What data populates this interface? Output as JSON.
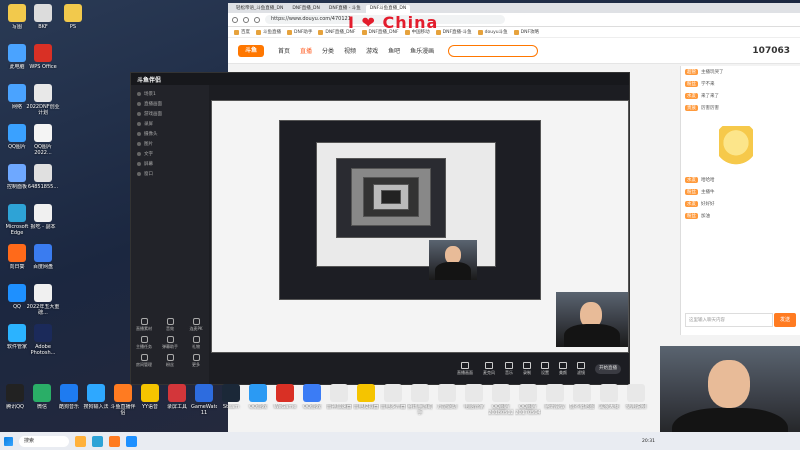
{
  "desktop": {
    "icons_left": [
      {
        "label": "写图",
        "color": "#f2c94c"
      },
      {
        "label": "此电脑",
        "color": "#4aa3ff"
      },
      {
        "label": "网络",
        "color": "#4aa3ff"
      },
      {
        "label": "QQ图片",
        "color": "#3aa1ff"
      },
      {
        "label": "控制面板",
        "color": "#6ea8ff"
      },
      {
        "label": "Microsoft Edge",
        "color": "#2ea3d6"
      },
      {
        "label": "向日葵",
        "color": "#ff6a1a"
      },
      {
        "label": "QQ",
        "color": "#1e90ff"
      },
      {
        "label": "软件管家",
        "color": "#2bb3ff"
      }
    ],
    "icons_col2": [
      {
        "label": "BKF",
        "color": "#dcdcdc"
      },
      {
        "label": "WPS Office",
        "color": "#d93025"
      },
      {
        "label": "2022DNF创业计划",
        "color": "#e8e8e8"
      },
      {
        "label": "QQ图片2022...",
        "color": "#f4f4f4"
      },
      {
        "label": "64851855...",
        "color": "#e0e0e0"
      },
      {
        "label": "报吃 - 副本",
        "color": "#f0f0f0"
      },
      {
        "label": "百度网盘",
        "color": "#3a7cf0"
      },
      {
        "label": "2022年五大重磅...",
        "color": "#f0f0f0"
      },
      {
        "label": "Adobe Photosh...",
        "color": "#1b2a5a"
      }
    ],
    "icons_col3": [
      {
        "label": "PS",
        "color": "#f2c94c"
      }
    ],
    "bottom_row": [
      {
        "label": "腾讯QQ",
        "color": "#222"
      },
      {
        "label": "微信",
        "color": "#2aae67"
      },
      {
        "label": "酷狗音乐",
        "color": "#1e7bf0"
      },
      {
        "label": "搜狗输入法",
        "color": "#2ea8ff"
      },
      {
        "label": "斗鱼直播伴侣",
        "color": "#ff7b21"
      },
      {
        "label": "YY语音",
        "color": "#f5c400"
      },
      {
        "label": "录屏工具",
        "color": "#d3363a"
      },
      {
        "label": "GameWatch 11",
        "color": "#2d6cdf"
      },
      {
        "label": "Steam",
        "color": "#1b2838"
      },
      {
        "label": "QQ游戏",
        "color": "#2b9af3"
      },
      {
        "label": "WeGame",
        "color": "#d93025"
      },
      {
        "label": "QQ游戏",
        "color": "#3b7cf5"
      },
      {
        "label": "雷神加速器",
        "color": "#e8e8e8"
      },
      {
        "label": "雷电模拟器",
        "color": "#f5c400"
      },
      {
        "label": "雷电多开器",
        "color": "#e8e8e8"
      },
      {
        "label": "腾讯手游助手",
        "color": "#e8e8e8"
      },
      {
        "label": "万能驱动",
        "color": "#e8e8e8"
      },
      {
        "label": "电脑管家",
        "color": "#e8e8e8"
      },
      {
        "label": "QQ图片20180512",
        "color": "#e8e8e8"
      },
      {
        "label": "QQ图片20170504",
        "color": "#e8e8e8"
      },
      {
        "label": "腾讯会议",
        "color": "#e8e8e8"
      },
      {
        "label": "鼓不偏地图",
        "color": "#e8e8e8"
      },
      {
        "label": "黑猴大赛",
        "color": "#e8e8e8"
      },
      {
        "label": "使用说明",
        "color": "#e8e8e8"
      }
    ]
  },
  "browser": {
    "tabs": [
      "轻松帝语_斗鱼直播_DN",
      "DNF直播_DN",
      "DNF直播 - 斗鱼",
      "DNF斗鱼直播_DN"
    ],
    "url": "https://www.douyu.com/470121",
    "bookmarks": [
      "百度",
      "斗鱼直播",
      "DNF助手",
      "DNF直播_DNF",
      "DNF直播_DNF",
      "中国移动",
      "DNF直播-斗鱼",
      "douyu斗鱼",
      "DNF攻略"
    ],
    "china_banner": "I ❤ China",
    "nav": [
      "首页",
      "直播",
      "分类",
      "视频",
      "游戏",
      "鱼吧",
      "鱼乐漫画"
    ],
    "nav_active": 1,
    "viewer_count": "107063",
    "chat": {
      "rows": [
        {
          "badge": "超管",
          "text": "主播玩哭了"
        },
        {
          "badge": "粉丝",
          "text": "学不来"
        },
        {
          "badge": "水友",
          "text": "来了来了"
        },
        {
          "badge": "贵族",
          "text": "厉害厉害"
        },
        {
          "badge": "水友",
          "text": "哈哈哈"
        },
        {
          "badge": "粉丝",
          "text": "主播牛"
        },
        {
          "badge": "水友",
          "text": "好好好"
        },
        {
          "badge": "粉丝",
          "text": "加油"
        }
      ],
      "input_placeholder": "这里输入聊天内容",
      "send": "发送"
    }
  },
  "app": {
    "title": "斗鱼伴侣",
    "scenes": [
      "场景1",
      "直播画面",
      "游戏画面",
      "录屏",
      "摄像头",
      "图片",
      "文字",
      "屏幕",
      "窗口"
    ],
    "tools": [
      "直播素材",
      "音效",
      "连麦PK",
      "主播任务",
      "弹幕助手",
      "礼物",
      "房间管理",
      "粉丝",
      "更多"
    ],
    "bottom_tools": [
      "直播画面",
      "麦克风",
      "音乐",
      "录制",
      "设置",
      "美颜",
      "滤镜"
    ],
    "go_live": "开始直播"
  },
  "taskbar": {
    "search": "搜索",
    "clock": "20:31"
  }
}
